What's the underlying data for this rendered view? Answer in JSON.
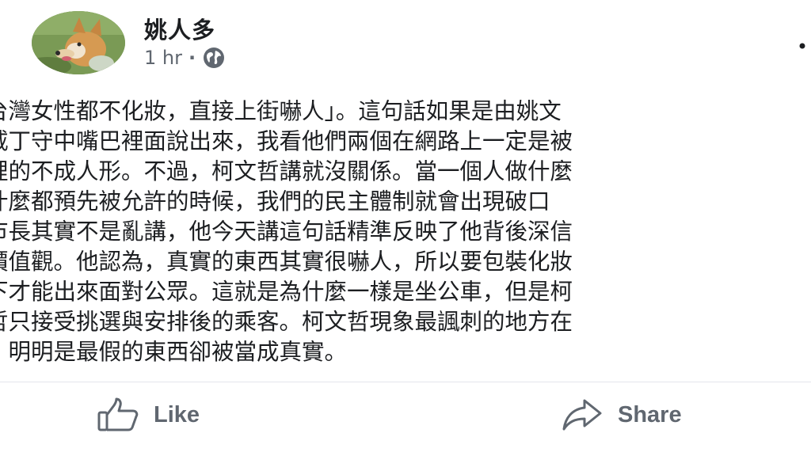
{
  "post": {
    "author": "姚人多",
    "time": "1 hr",
    "separator": "·",
    "lines": [
      "台灣女性都不化妝，直接上街嚇人」。這句話如果是由姚文",
      "戚丁守中嘴巴裡面說出來，我看他們兩個在網路上一定是被",
      "裡的不成人形。不過，柯文哲講就沒關係。當一個人做什麼",
      "什麼都預先被允許的時候，我們的民主體制就會出現破口",
      "市長其實不是亂講，他今天講這句話精準反映了他背後深信",
      "價值觀。他認為，真實的東西其實很嚇人，所以要包裝化妝",
      "下才能出來面對公眾。這就是為什麼一樣是坐公車，但是柯",
      "哲只接受挑選與安排後的乘客。柯文哲現象最諷刺的地方在",
      "，明明是最假的東西卻被當成真實。"
    ]
  },
  "actions": {
    "like": "Like",
    "share": "Share"
  },
  "icons": {
    "globe": "globe-icon",
    "like": "thumbs-up-icon",
    "share": "share-arrow-icon",
    "more": "more-options-icon"
  },
  "colors": {
    "text": "#1c1e21",
    "secondary": "#606770",
    "divider": "#e4e6eb"
  }
}
